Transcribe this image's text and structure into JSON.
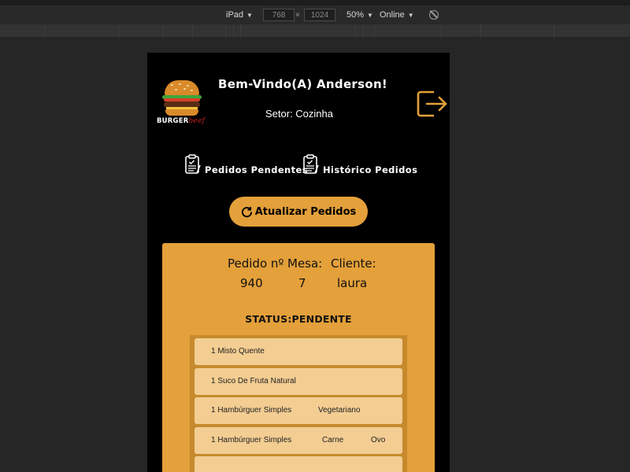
{
  "devtools": {
    "device": "iPad",
    "width": "768",
    "times": "×",
    "height": "1024",
    "zoom": "50%",
    "network": "Online"
  },
  "header": {
    "logo_text": "BURGER",
    "logo_script": "beef",
    "welcome": "Bem-Vindo(A) Anderson!",
    "sector": "Setor: Cozinha"
  },
  "nav": {
    "pending": "Pedidos Pendentes",
    "history": "Histórico Pedidos"
  },
  "refresh_button": "Atualizar Pedidos",
  "order": {
    "number_label": "Pedido nº",
    "number": "940",
    "table_label": "Mesa:",
    "table": "7",
    "client_label": "Cliente:",
    "client": "laura",
    "status": "STATUS:PENDENTE",
    "items": [
      {
        "name": "1 Misto Quente"
      },
      {
        "name": "1 Suco De Fruta Natural"
      },
      {
        "name": "1 Hambúrguer Simples",
        "option1": "Vegetariano"
      },
      {
        "name": "1 Hambúrguer Simples",
        "option1": "Carne",
        "option2": "Ovo"
      }
    ]
  },
  "colors": {
    "accent": "#e4a03a",
    "item_bg": "#f3cd92",
    "background": "#000000",
    "devtools_bg": "#262626"
  },
  "icons": [
    "burger-logo-icon",
    "logout-icon",
    "clipboard-check-icon",
    "refresh-icon",
    "rotate-device-icon"
  ]
}
